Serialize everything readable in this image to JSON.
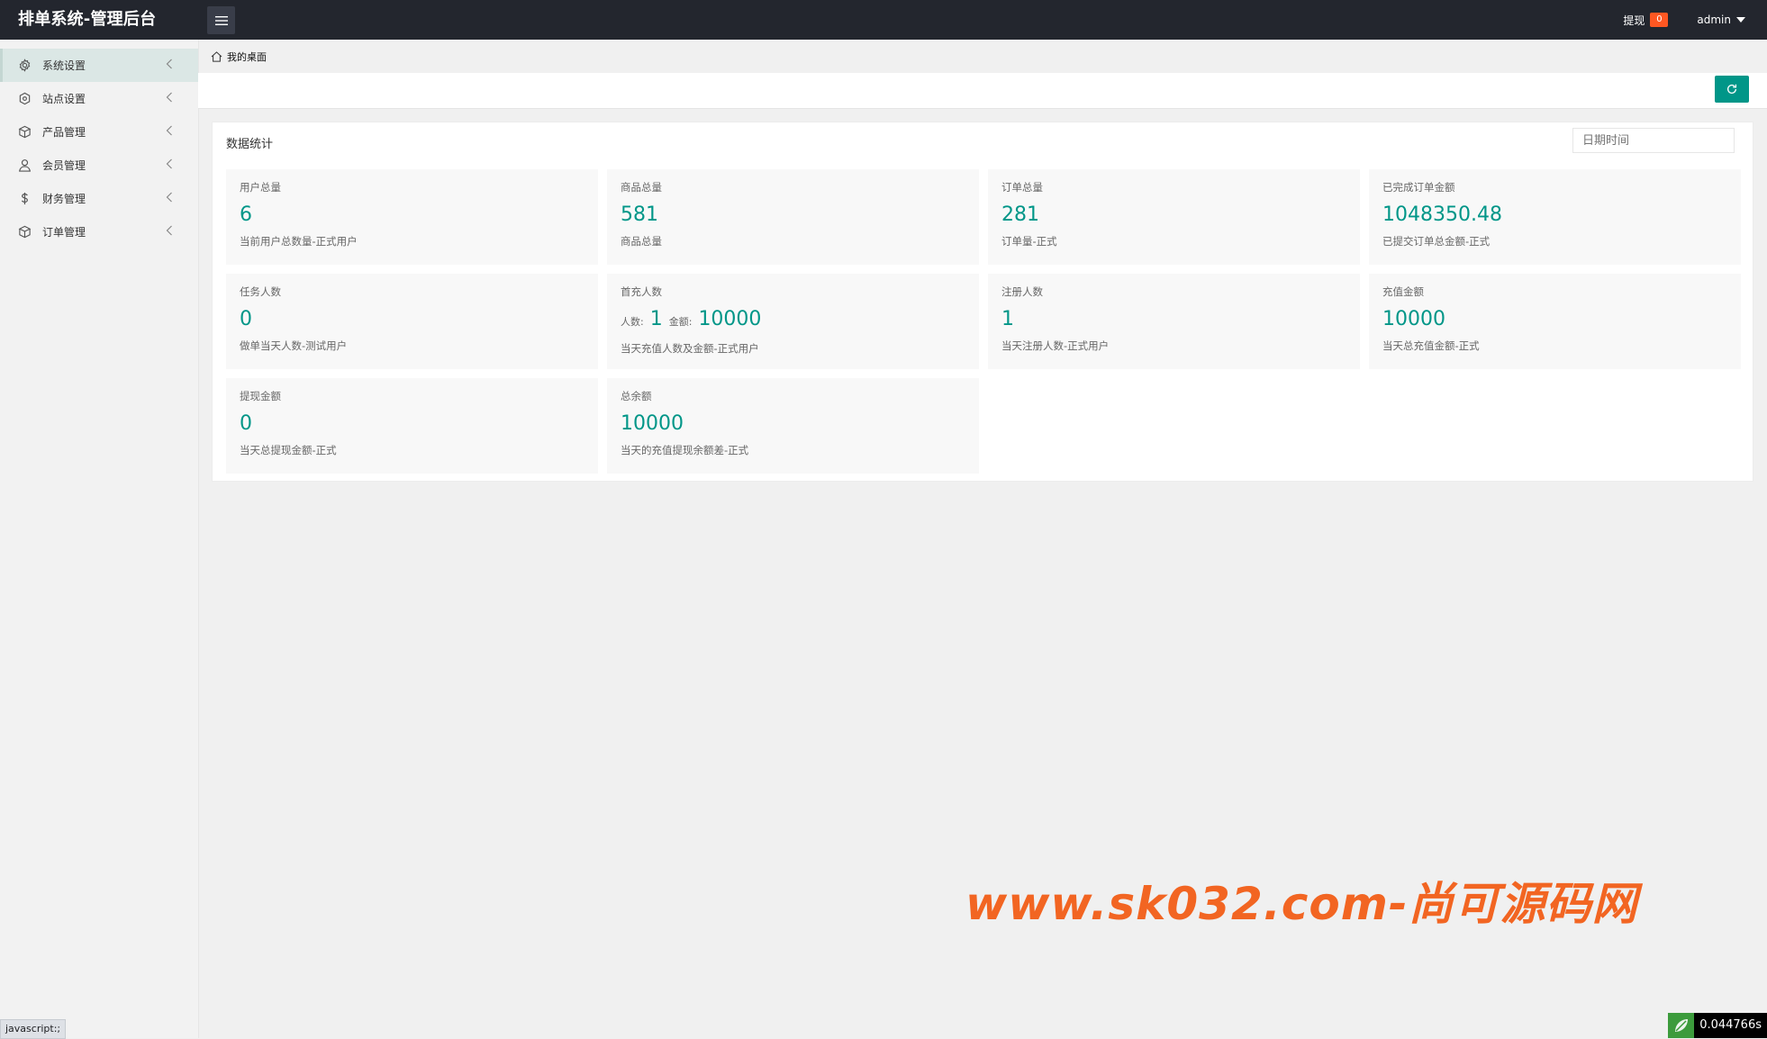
{
  "header": {
    "title": "排单系统-管理后台",
    "withdraw_label": "提现",
    "withdraw_count": "0",
    "user": "admin"
  },
  "sidebar": {
    "items": [
      {
        "label": "系统设置",
        "icon": "gear-icon"
      },
      {
        "label": "站点设置",
        "icon": "cube-outline-icon"
      },
      {
        "label": "产品管理",
        "icon": "box-icon"
      },
      {
        "label": "会员管理",
        "icon": "user-icon"
      },
      {
        "label": "财务管理",
        "icon": "dollar-icon"
      },
      {
        "label": "订单管理",
        "icon": "box-icon"
      }
    ]
  },
  "breadcrumb": {
    "label": "我的桌面"
  },
  "panel": {
    "title": "数据统计",
    "date_placeholder": "日期时间",
    "cards": [
      {
        "title": "用户总量",
        "value": "6",
        "desc": "当前用户总数量-正式用户"
      },
      {
        "title": "商品总量",
        "value": "581",
        "desc": "商品总量"
      },
      {
        "title": "订单总量",
        "value": "281",
        "desc": "订单量-正式"
      },
      {
        "title": "已完成订单金额",
        "value": "1048350.48",
        "desc": "已提交订单总金额-正式"
      },
      {
        "title": "任务人数",
        "value": "0",
        "desc": "做单当天人数-测试用户"
      },
      {
        "title": "首充人数",
        "people_label": "人数:",
        "people_value": "1",
        "amount_label": "金额:",
        "amount_value": "10000",
        "desc": "当天充值人数及金额-正式用户"
      },
      {
        "title": "注册人数",
        "value": "1",
        "desc": "当天注册人数-正式用户"
      },
      {
        "title": "充值金额",
        "value": "10000",
        "desc": "当天总充值金额-正式"
      },
      {
        "title": "提现金额",
        "value": "0",
        "desc": "当天总提现金额-正式"
      },
      {
        "title": "总余额",
        "value": "10000",
        "desc": "当天的充值提现余额差-正式"
      }
    ]
  },
  "watermark": "www.sk032.com-尚可源码网",
  "status_link": "javascript:;",
  "timer": "0.044766s",
  "colors": {
    "accent": "#009688",
    "header": "#23262e",
    "badge": "#ff5722",
    "watermark": "#f26522"
  }
}
